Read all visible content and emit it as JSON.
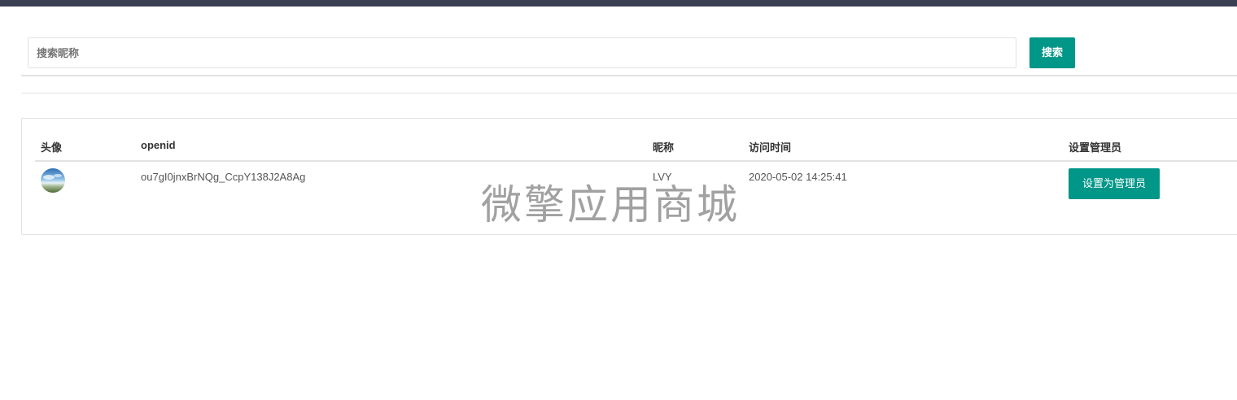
{
  "search": {
    "placeholder": "搜索昵称",
    "value": "",
    "button_label": "搜索"
  },
  "table": {
    "columns": [
      "头像",
      "openid",
      "昵称",
      "访问时间",
      "设置管理员"
    ],
    "rows": [
      {
        "avatar": "avatar-image",
        "openid": "ou7gI0jnxBrNQg_CcpY138J2A8Ag",
        "nickname": "LVY",
        "visit_time": "2020-05-02 14:25:41",
        "action_label": "设置为管理员"
      }
    ]
  },
  "watermark": "微擎应用商城",
  "colors": {
    "top_bar": "#3a3f51",
    "accent": "#009688",
    "border": "#e2e2e2"
  }
}
